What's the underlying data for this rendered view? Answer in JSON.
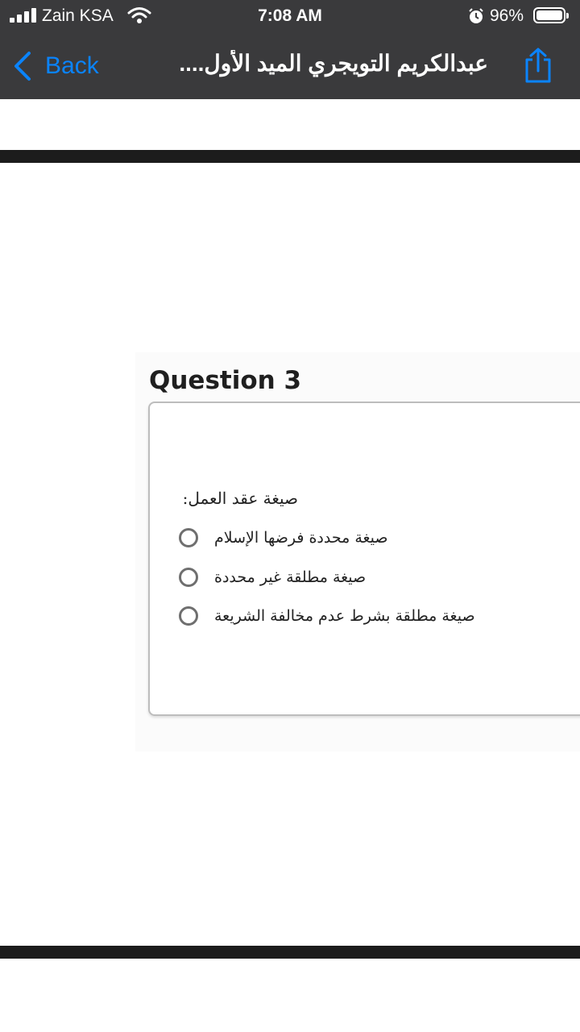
{
  "status_bar": {
    "carrier": "Zain KSA",
    "time": "7:08 AM",
    "battery_percent": "96%",
    "icons": [
      "signal-icon",
      "wifi-icon",
      "alarm-icon",
      "battery-icon"
    ]
  },
  "nav": {
    "back_label": "Back",
    "title": "عبدالكريم التويجري الميد الأول....",
    "accent_color": "#0a84ff",
    "icons": [
      "chevron-left-icon",
      "share-icon"
    ]
  },
  "question": {
    "title": "Question 3",
    "prompt": "صيغة عقد العمل:",
    "options": [
      "صيغة محددة فرضها الإسلام",
      "صيغة مطلقة غير محددة",
      "صيغة مطلقة بشرط عدم مخالفة الشريعة"
    ]
  }
}
